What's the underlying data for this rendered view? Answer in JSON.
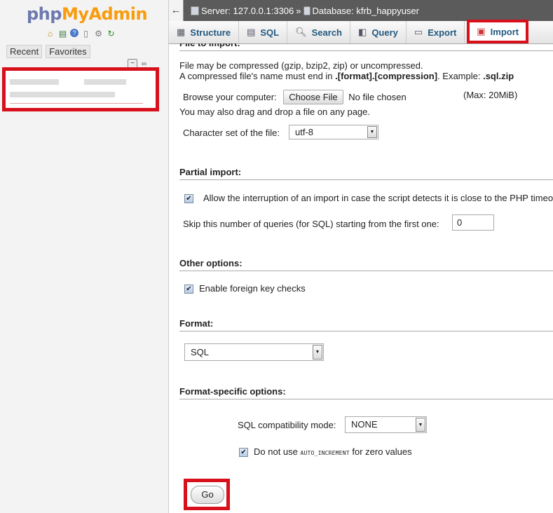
{
  "sidebar": {
    "logo_php": "php",
    "logo_myadmin": "MyAdmin",
    "icons": [
      "home-icon",
      "exit-icon",
      "help-icon",
      "docs-icon",
      "settings-icon",
      "reload-icon"
    ],
    "recent_label": "Recent",
    "favorites_label": "Favorites"
  },
  "topbar": {
    "back_glyph": "←",
    "server_label": "Server: 127.0.0.1:3306",
    "separator": "»",
    "database_label": "Database: kfrb_happyuser"
  },
  "tabs": [
    {
      "label": "Structure",
      "icon": "structure-icon"
    },
    {
      "label": "SQL",
      "icon": "sql-icon"
    },
    {
      "label": "Search",
      "icon": "search-icon"
    },
    {
      "label": "Query",
      "icon": "query-icon"
    },
    {
      "label": "Export",
      "icon": "export-icon"
    },
    {
      "label": "Import",
      "icon": "import-icon"
    }
  ],
  "file_import": {
    "heading": "File to import:",
    "line1": "File may be compressed (gzip, bzip2, zip) or uncompressed.",
    "line2_prefix": "A compressed file's name must end in ",
    "line2_pattern": ".[format].[compression]",
    "line2_mid": ". Example: ",
    "line2_example": ".sql.zip",
    "browse_label": "Browse your computer:",
    "choose_file_label": "Choose File",
    "no_file_label": "No file chosen",
    "max_label": "(Max: 20MiB)",
    "drag_drop_label": "You may also drag and drop a file on any page.",
    "charset_label": "Character set of the file:",
    "charset_value": "utf-8"
  },
  "partial_import": {
    "heading": "Partial import:",
    "allow_interrupt_label": "Allow the interruption of an import in case the script detects it is close to the PHP timeo",
    "allow_interrupt_checked": true,
    "skip_label": "Skip this number of queries (for SQL) starting from the first one:",
    "skip_value": "0"
  },
  "other_options": {
    "heading": "Other options:",
    "fk_checks_label": "Enable foreign key checks",
    "fk_checks_checked": true
  },
  "format": {
    "heading": "Format:",
    "value": "SQL"
  },
  "format_specific": {
    "heading": "Format-specific options:",
    "compat_label": "SQL compatibility mode:",
    "compat_value": "NONE",
    "auto_inc_prefix": "Do not use ",
    "auto_inc_code": "AUTO_INCREMENT",
    "auto_inc_suffix": " for zero values",
    "auto_inc_checked": true
  },
  "go_label": "Go",
  "highlight_color": "#d8101b"
}
